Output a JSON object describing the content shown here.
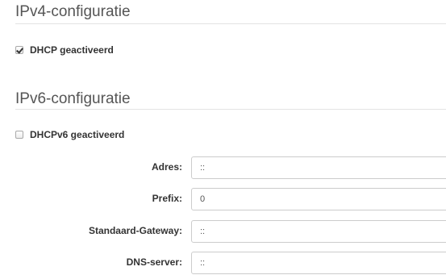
{
  "ipv4": {
    "title": "IPv4-configuratie",
    "dhcp_label": "DHCP geactiveerd",
    "dhcp_checked": true
  },
  "ipv6": {
    "title": "IPv6-configuratie",
    "dhcp_label": "DHCPv6 geactiveerd",
    "dhcp_checked": false,
    "fields": {
      "address": {
        "label": "Adres:",
        "value": "::"
      },
      "prefix": {
        "label": "Prefix:",
        "value": "0"
      },
      "gateway": {
        "label": "Standaard-Gateway:",
        "value": "::"
      },
      "dns": {
        "label": "DNS-server:",
        "value": "::"
      }
    }
  }
}
